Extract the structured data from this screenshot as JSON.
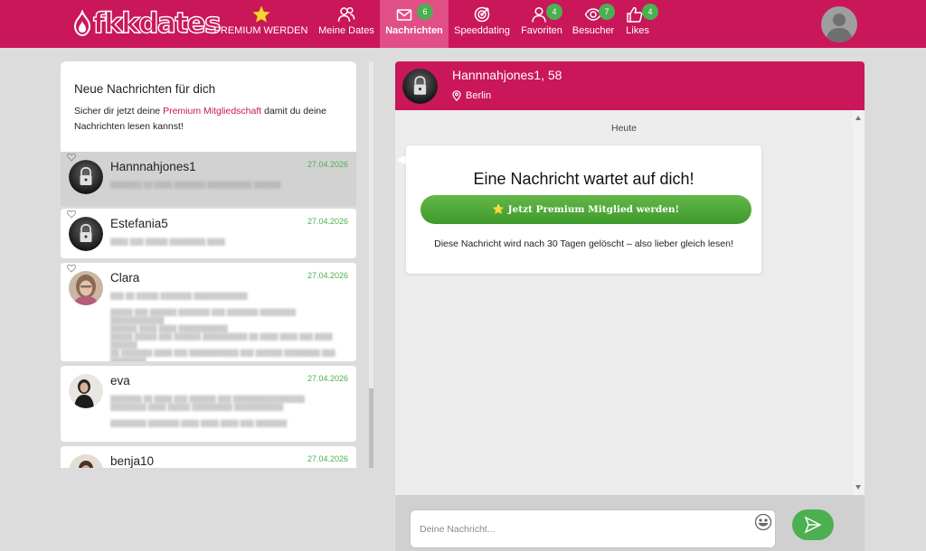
{
  "header": {
    "logo_text": "fkkdates",
    "nav": [
      {
        "label": "PREMIUM WERDEN",
        "icon": "star-icon",
        "badge": null,
        "active": false
      },
      {
        "label": "Meine Dates",
        "icon": "users-icon",
        "badge": null,
        "active": false
      },
      {
        "label": "Nachrichten",
        "icon": "mail-icon",
        "badge": "6",
        "active": true
      },
      {
        "label": "Speeddating",
        "icon": "target-icon",
        "badge": null,
        "active": false
      },
      {
        "label": "Favoriten",
        "icon": "user-icon",
        "badge": "4",
        "active": false
      },
      {
        "label": "Besucher",
        "icon": "eye-icon",
        "badge": "7",
        "active": false
      },
      {
        "label": "Likes",
        "icon": "thumbs-up-icon",
        "badge": "4",
        "active": false
      }
    ],
    "colors": {
      "brand": "#c9175a",
      "active_tab": "#e14f87",
      "badge": "#4caf50"
    }
  },
  "inbox": {
    "title": "Neue Nachrichten für dich",
    "text_before": "Sicher dir jetzt deine ",
    "link_text": "Premium Mitgliedschaft",
    "text_after": " damit du deine Nachrichten lesen kannst!",
    "conversations": [
      {
        "name": "Hannnahjones1",
        "date": "27.04.2026",
        "avatar": "lock-icon",
        "selected": true
      },
      {
        "name": "Estefania5",
        "date": "27.04.2026",
        "avatar": "lock-icon",
        "selected": false
      },
      {
        "name": "Clara",
        "date": "27.04.2026",
        "avatar": "photo",
        "selected": false
      },
      {
        "name": "eva",
        "date": "27.04.2026",
        "avatar": "photo",
        "selected": false
      },
      {
        "name": "benja10",
        "date": "27.04.2026",
        "avatar": "photo",
        "selected": false
      }
    ]
  },
  "chat": {
    "name": "Hannnahjones1, 58",
    "location": "Berlin",
    "day_label": "Heute",
    "card_title": "Eine Nachricht wartet auf dich!",
    "cta_label": "⭐ Jetzt Premium Mitglied werden!",
    "note": "Diese Nachricht wird nach 30 Tagen gelöscht – also lieber gleich lesen!",
    "input_placeholder": "Deine Nachricht..."
  }
}
